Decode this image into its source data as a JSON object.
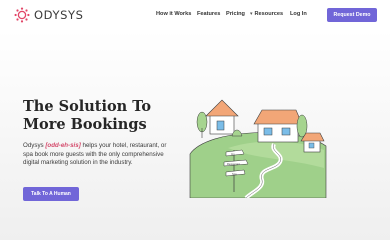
{
  "brand": {
    "name": "ODYSYS",
    "accent": "#7166d8",
    "logo_color": "#e24567"
  },
  "nav": {
    "items": [
      {
        "label": "How it Works"
      },
      {
        "label": "Features"
      },
      {
        "label": "Pricing"
      },
      {
        "label": "Resources",
        "icon": "chevron-down-icon"
      },
      {
        "label": "Log In"
      }
    ],
    "cta_label": "Request Demo"
  },
  "hero": {
    "title": "The Solution To More Bookings",
    "desc_brand": "Odysys",
    "desc_phonetic": "[odd-eh-sis]",
    "desc_rest": "helps your hotel, restaurant, or spa book more guests with the only comprehensive digital marketing solution in the industry.",
    "button_label": "Talk To A Human"
  },
  "illustration": {
    "signpost": [
      "Inn",
      "Restaurant",
      "Spa"
    ]
  }
}
